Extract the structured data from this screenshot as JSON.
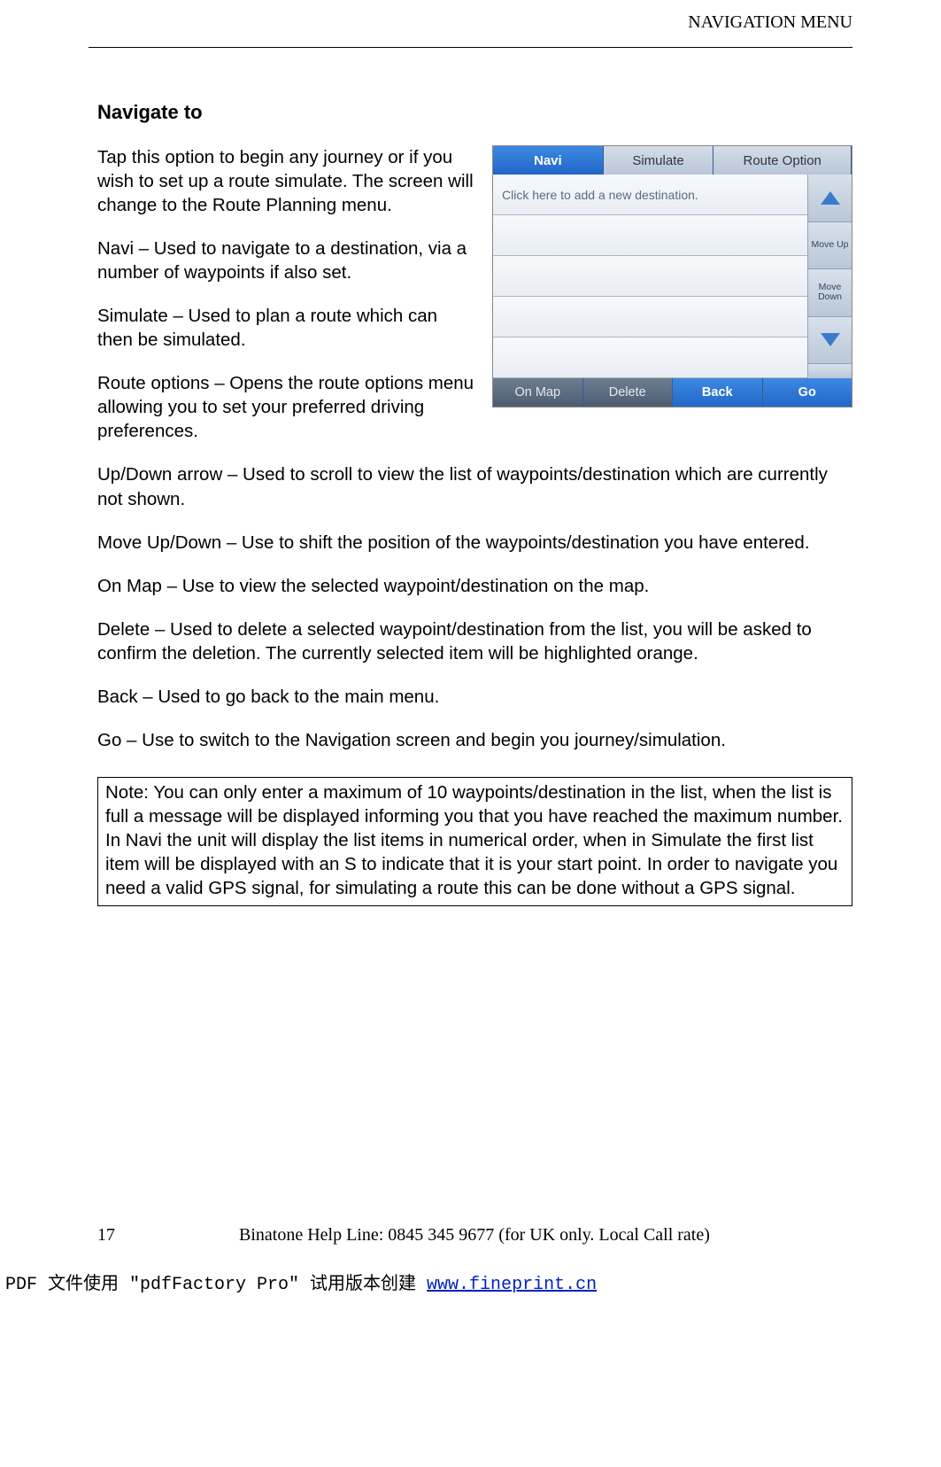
{
  "header": {
    "title": "NAVIGATION MENU"
  },
  "section": {
    "title": "Navigate to"
  },
  "paras": {
    "intro": "Tap this option to begin any journey or if you wish to set up a route simulate. The screen will change to the Route Planning menu.",
    "navi": "Navi – Used to navigate to a destination, via a number of waypoints if also set.",
    "simulate": "Simulate – Used to plan a route which can then be simulated.",
    "routeopt": "Route options – Opens the route options menu allowing you to set your preferred driving preferences.",
    "updown": "Up/Down arrow – Used to scroll to view the list of waypoints/destination which are currently not shown.",
    "moveud": "Move Up/Down – Use to shift the position of the waypoints/destination you have entered.",
    "onmap": "On Map – Use to view the selected waypoint/destination on the map.",
    "delete": "Delete – Used to delete a selected waypoint/destination from the list, you will be asked to confirm the deletion. The currently selected item will be highlighted orange.",
    "back": "Back – Used to go back to the main menu.",
    "go": "Go – Use to switch to the Navigation screen and begin you journey/simulation."
  },
  "note": "Note: You can only enter a maximum of 10 waypoints/destination in the list, when the list is full a message will be displayed informing you that you have reached the maximum number.\nIn Navi the unit will display the list items in numerical order, when in Simulate the first list item will be displayed with an S to indicate that it is your start point. In order to navigate you need a valid GPS signal, for simulating a route this can be done without a GPS signal.",
  "screenshot": {
    "tabs": {
      "navi": "Navi",
      "simulate": "Simulate",
      "routeopt": "Route Option"
    },
    "placeholder": "Click here to add a new destination.",
    "side": {
      "moveup": "Move Up",
      "movedown": "Move Down"
    },
    "bottom": {
      "onmap": "On Map",
      "delete": "Delete",
      "back": "Back",
      "go": "Go"
    }
  },
  "footer": {
    "page": "17",
    "help": "Binatone Help Line: 0845 345 9677 (for UK only. Local Call rate)"
  },
  "pdffooter": {
    "prefix": "PDF 文件使用 \"pdfFactory Pro\" 试用版本创建 ",
    "link": "www.fineprint.cn"
  }
}
